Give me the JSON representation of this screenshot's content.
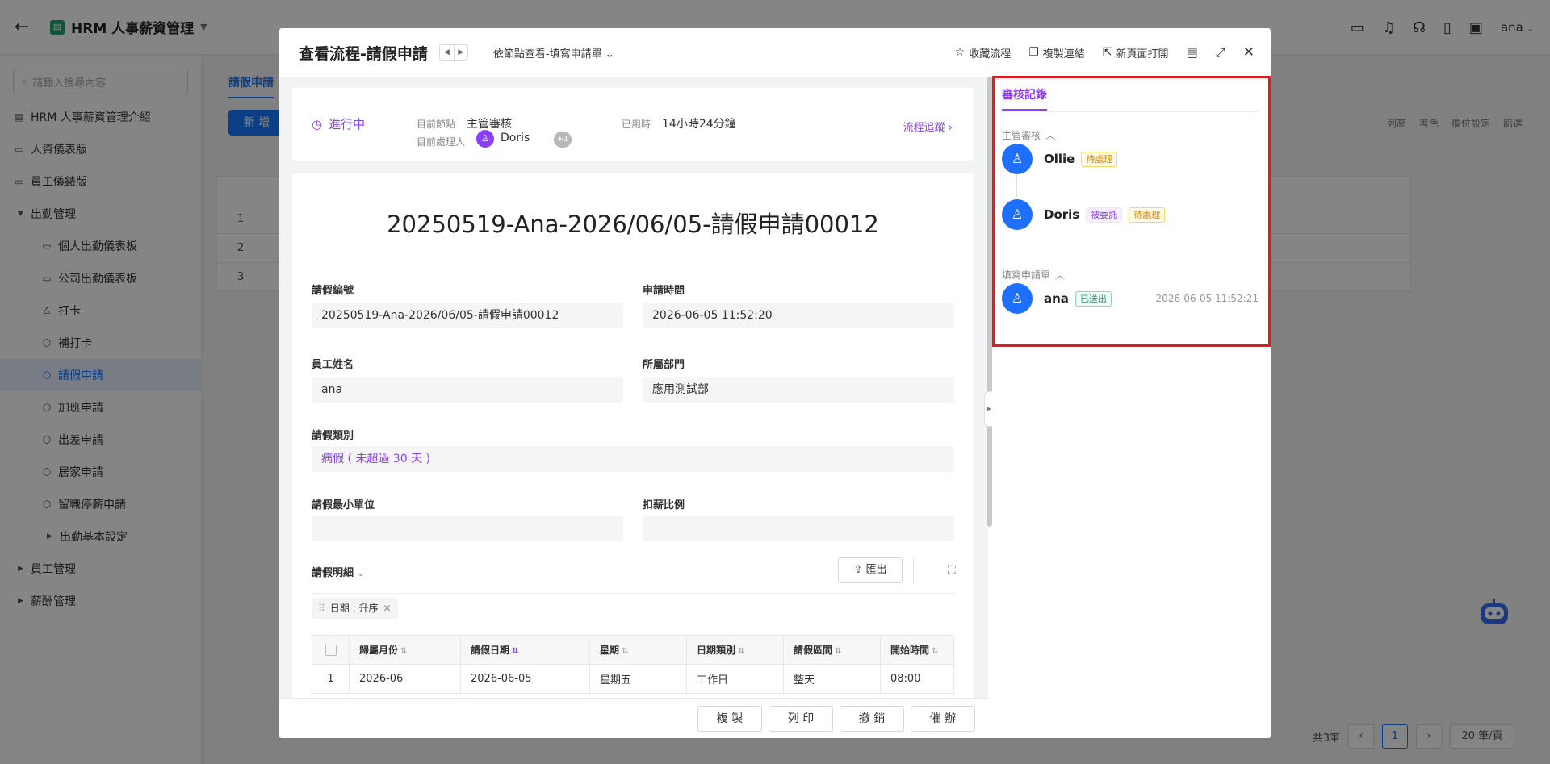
{
  "topbar": {
    "app_title": "HRM 人事薪資管理",
    "user": "ana"
  },
  "sidebar": {
    "search_placeholder": "請輸入搜尋內容",
    "items": [
      {
        "label": "HRM 人事薪資管理介紹"
      },
      {
        "label": "人資儀表版"
      },
      {
        "label": "員工儀錶版"
      },
      {
        "label": "出勤管理"
      },
      {
        "label": "個人出勤儀表板"
      },
      {
        "label": "公司出勤儀表板"
      },
      {
        "label": "打卡"
      },
      {
        "label": "補打卡"
      },
      {
        "label": "請假申請"
      },
      {
        "label": "加班申請"
      },
      {
        "label": "出差申請"
      },
      {
        "label": "居家申請"
      },
      {
        "label": "留職停薪申請"
      },
      {
        "label": "出勤基本設定"
      },
      {
        "label": "員工管理"
      },
      {
        "label": "薪酬管理"
      }
    ]
  },
  "background": {
    "tab_label": "請假申請",
    "new_button": "新 增",
    "row_numbers": [
      "1",
      "2",
      "3"
    ],
    "tools": [
      "列高",
      "著色",
      "欄位設定",
      "篩選"
    ],
    "pager_total": "共3筆",
    "pager_current": "1",
    "pager_size": "20 筆/頁"
  },
  "modal": {
    "title": "查看流程-請假申請",
    "view_selector": "依節點查看-填寫申請單",
    "actions": {
      "favorite": "收藏流程",
      "copy_link": "複製連結",
      "open_new_page": "新頁面打開"
    },
    "status": {
      "state": "進行中",
      "current_node_label": "目前節點",
      "current_node": "主管審核",
      "elapsed_label": "已用時",
      "elapsed": "14小時24分鐘",
      "handler_label": "目前處理人",
      "handler": "Doris",
      "handler_extra": "+1",
      "track_link": "流程追蹤"
    },
    "form": {
      "title": "20250519-Ana-2026/06/05-請假申請00012",
      "leave_no_label": "請假編號",
      "leave_no": "20250519-Ana-2026/06/05-請假申請00012",
      "apply_time_label": "申請時間",
      "apply_time": "2026-06-05 11:52:20",
      "employee_label": "員工姓名",
      "employee": "ana",
      "department_label": "所屬部門",
      "department": "應用測試部",
      "leave_type_label": "請假類別",
      "leave_type": "病假 ( 未超過 30 天 )",
      "min_unit_label": "請假最小單位",
      "min_unit": "",
      "deduct_label": "扣薪比例",
      "deduct": ""
    },
    "details": {
      "label": "請假明細",
      "export": "匯出",
      "sort_chip": "日期 : 升序",
      "columns": [
        "歸屬月份",
        "請假日期",
        "星期",
        "日期類別",
        "請假區間",
        "開始時間"
      ],
      "rows": [
        {
          "no": "1",
          "month": "2026-06",
          "date": "2026-06-05",
          "weekday": "星期五",
          "date_type": "工作日",
          "period": "整天",
          "start": "08:00"
        }
      ]
    },
    "footer": {
      "copy": "複 製",
      "print": "列 印",
      "revoke": "撤 銷",
      "remind": "催 辦"
    },
    "review": {
      "tab": "審核記錄",
      "groups": [
        {
          "name": "主管審核",
          "entries": [
            {
              "name": "Ollie",
              "tags": [
                "待處理"
              ]
            },
            {
              "name": "Doris",
              "tags": [
                "被委託",
                "待處理"
              ]
            }
          ]
        },
        {
          "name": "填寫申請單",
          "entries": [
            {
              "name": "ana",
              "tags": [
                "已送出"
              ],
              "time": "2026-06-05 11:52:21"
            }
          ]
        }
      ]
    }
  }
}
